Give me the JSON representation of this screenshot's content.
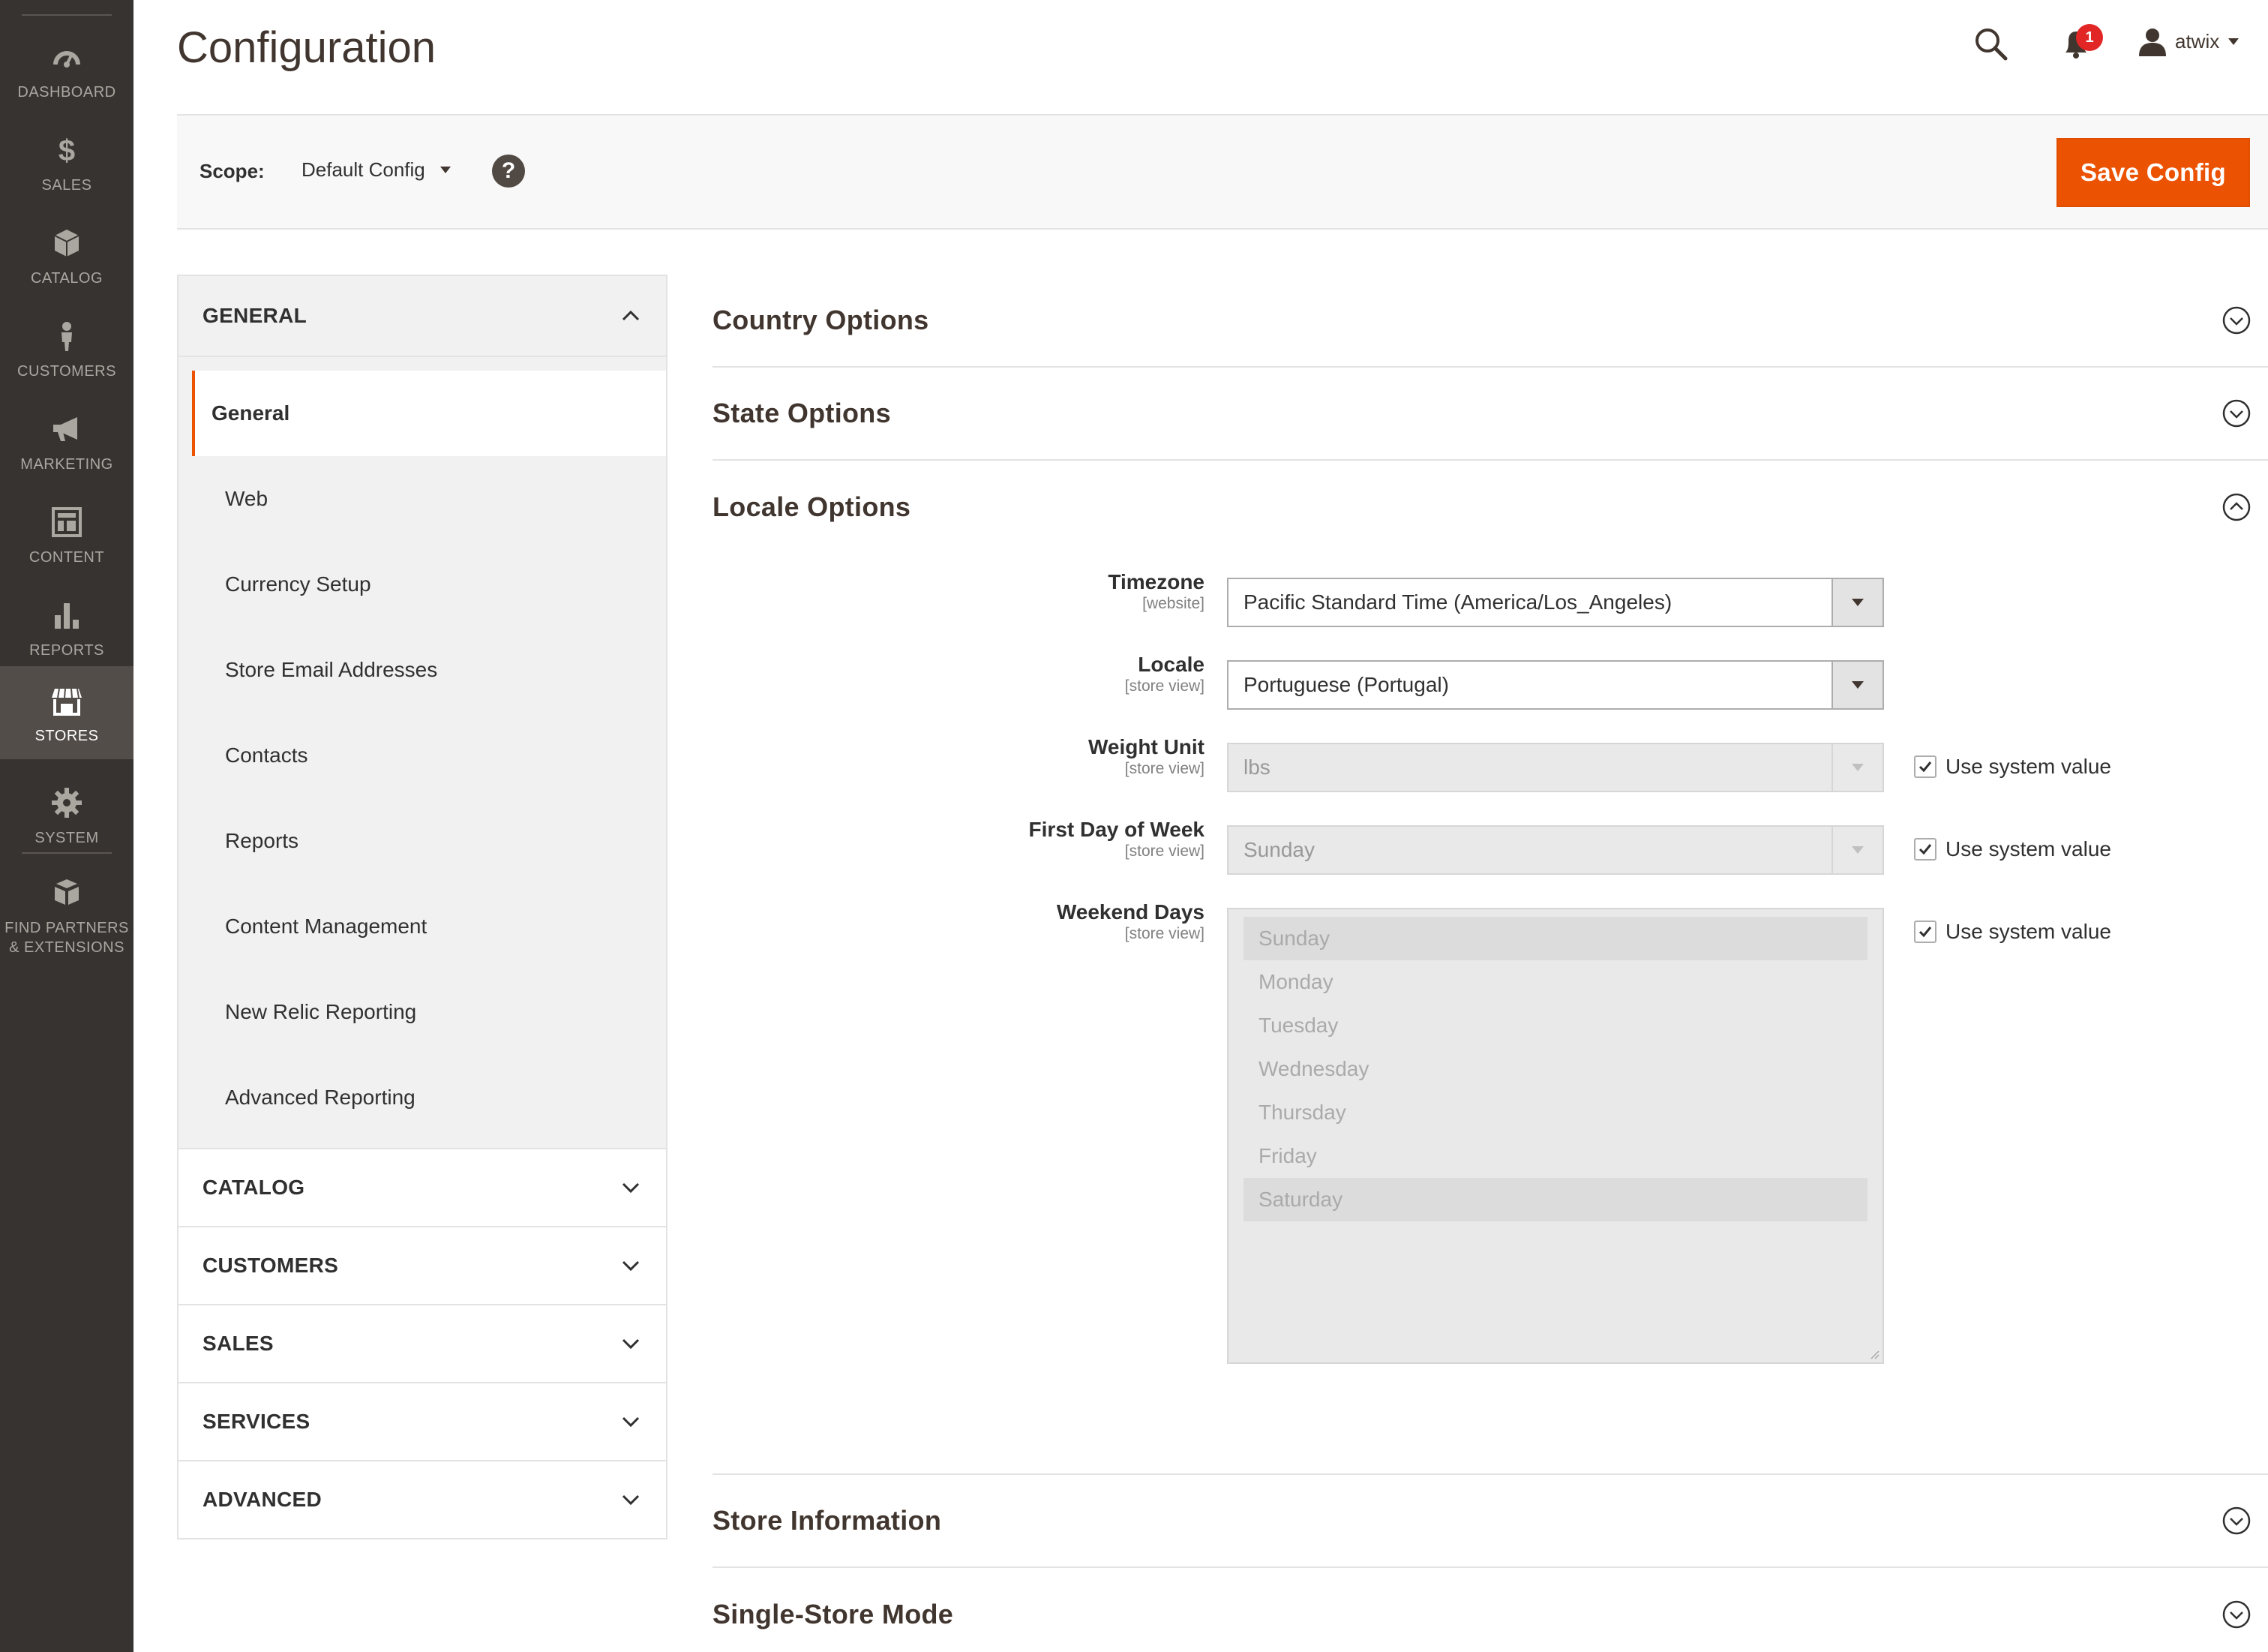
{
  "menu": {
    "items": [
      {
        "label": "DASHBOARD",
        "icon": "dashboard-icon"
      },
      {
        "label": "SALES",
        "icon": "dollar-icon"
      },
      {
        "label": "CATALOG",
        "icon": "box-icon"
      },
      {
        "label": "CUSTOMERS",
        "icon": "person-icon"
      },
      {
        "label": "MARKETING",
        "icon": "megaphone-icon"
      },
      {
        "label": "CONTENT",
        "icon": "layout-icon"
      },
      {
        "label": "REPORTS",
        "icon": "bar-chart-icon"
      },
      {
        "label": "STORES",
        "icon": "storefront-icon"
      },
      {
        "label": "SYSTEM",
        "icon": "gear-icon"
      },
      {
        "label": "FIND PARTNERS\n& EXTENSIONS",
        "icon": "boxes-icon"
      }
    ]
  },
  "header": {
    "title": "Configuration",
    "notifications_count": "1",
    "user_name": "atwix"
  },
  "scope": {
    "label": "Scope:",
    "value": "Default Config",
    "help": "?",
    "save_label": "Save Config"
  },
  "nav": {
    "general": {
      "title": "GENERAL",
      "items": [
        "General",
        "Web",
        "Currency Setup",
        "Store Email Addresses",
        "Contacts",
        "Reports",
        "Content Management",
        "New Relic Reporting",
        "Advanced Reporting"
      ]
    },
    "collapsed": [
      "CATALOG",
      "CUSTOMERS",
      "SALES",
      "SERVICES",
      "ADVANCED"
    ]
  },
  "sections": {
    "country": "Country Options",
    "state": "State Options",
    "locale": "Locale Options",
    "store_info": "Store Information",
    "single_store": "Single-Store Mode"
  },
  "locale": {
    "timezone": {
      "label": "Timezone",
      "scope": "[website]",
      "value": "Pacific Standard Time (America/Los_Angeles)"
    },
    "locale": {
      "label": "Locale",
      "scope": "[store view]",
      "value": "Portuguese (Portugal)"
    },
    "weight_unit": {
      "label": "Weight Unit",
      "scope": "[store view]",
      "value": "lbs",
      "use_system": "Use system value"
    },
    "first_day": {
      "label": "First Day of Week",
      "scope": "[store view]",
      "value": "Sunday",
      "use_system": "Use system value"
    },
    "weekend_days": {
      "label": "Weekend Days",
      "scope": "[store view]",
      "use_system": "Use system value",
      "options": [
        "Sunday",
        "Monday",
        "Tuesday",
        "Wednesday",
        "Thursday",
        "Friday",
        "Saturday"
      ],
      "selected": [
        "Sunday",
        "Saturday"
      ]
    }
  },
  "colors": {
    "accent": "#eb5202",
    "menu_bg": "#373330",
    "menu_active": "#524d49",
    "badge": "#e22626"
  }
}
